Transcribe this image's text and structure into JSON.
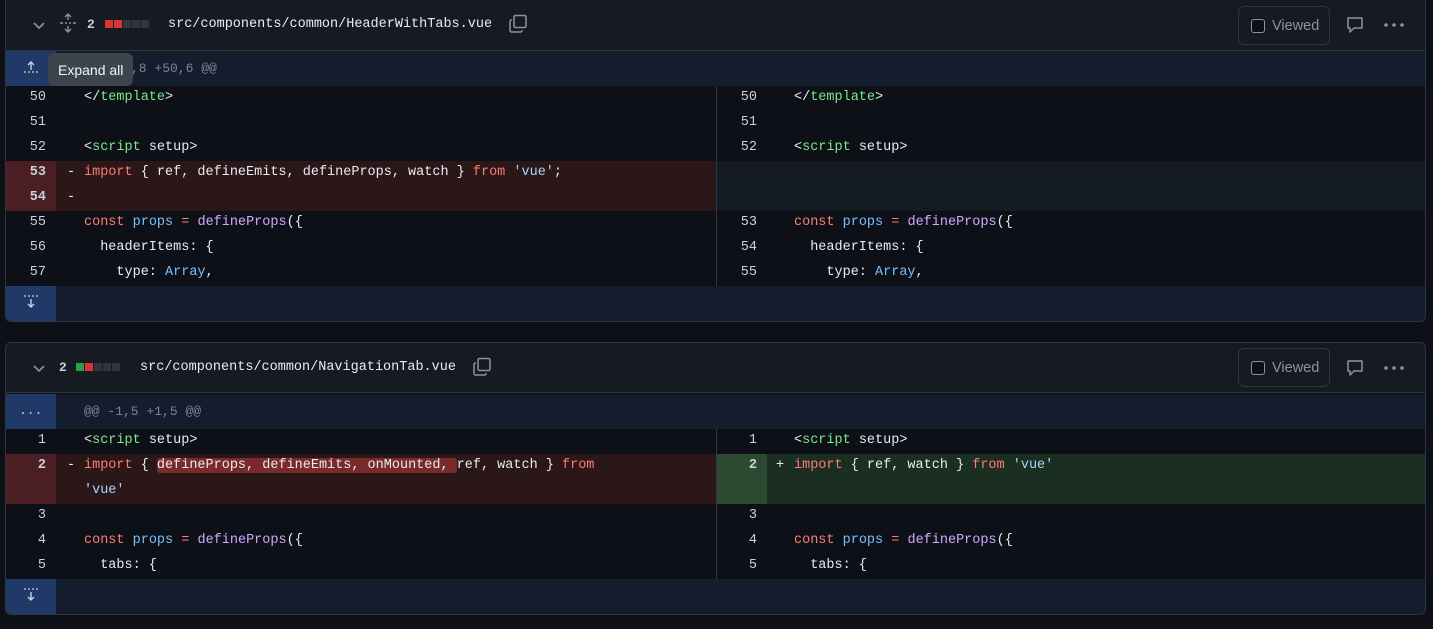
{
  "files": [
    {
      "changes": "2",
      "diffstat": [
        "del",
        "del",
        "neu",
        "neu",
        "neu"
      ],
      "filename": "src/components/common/HeaderWithTabs.vue",
      "viewed_label": "Viewed",
      "hunk": "@@ -50,8 +50,6 @@",
      "hunk_visible": ",8 +50,6 @@",
      "tooltip": "Expand all",
      "lines": [
        {
          "l": "50",
          "r": "50"
        },
        {
          "l": "51",
          "r": "51"
        },
        {
          "l": "52",
          "r": "52"
        },
        {
          "l": "53",
          "sign": "-"
        },
        {
          "l": "54",
          "sign": "-"
        },
        {
          "l": "55",
          "r": "53"
        },
        {
          "l": "56",
          "r": "54"
        },
        {
          "l": "57",
          "r": "55"
        }
      ]
    },
    {
      "changes": "2",
      "diffstat": [
        "add",
        "del",
        "neu",
        "neu",
        "neu"
      ],
      "filename": "src/components/common/NavigationTab.vue",
      "viewed_label": "Viewed",
      "hunk_btn": "...",
      "hunk": "@@ -1,5 +1,5 @@",
      "lines": [
        {
          "l": "1",
          "r": "1"
        },
        {
          "l": "2",
          "r": "2",
          "sign_l": "-",
          "sign_r": "+"
        },
        {
          "l": "3",
          "r": "3"
        },
        {
          "l": "4",
          "r": "4"
        },
        {
          "l": "5",
          "r": "5"
        }
      ]
    }
  ],
  "code": {
    "template_close": "</template>",
    "script_open": "<script setup>",
    "import_old1": "import { ref, defineEmits, defineProps, watch } from 'vue';",
    "const_props": "const props = defineProps({",
    "header_items": "headerItems: {",
    "type_array": "type: Array,",
    "import_old2_a": "import { defineProps, defineEmits, onMounted, ref, watch } from",
    "import_old2_b": "'vue'",
    "import_new2": "import { ref, watch } from 'vue'",
    "tabs": "tabs: {"
  },
  "icons": [
    "chevron-down-icon",
    "unfold-icon",
    "copy-icon",
    "comment-icon",
    "kebab-horizontal-icon",
    "fold-up-icon",
    "fold-down-icon"
  ],
  "colors": {
    "addition": "#2ea043",
    "deletion": "#da3633",
    "hunk": "#1f3968"
  }
}
